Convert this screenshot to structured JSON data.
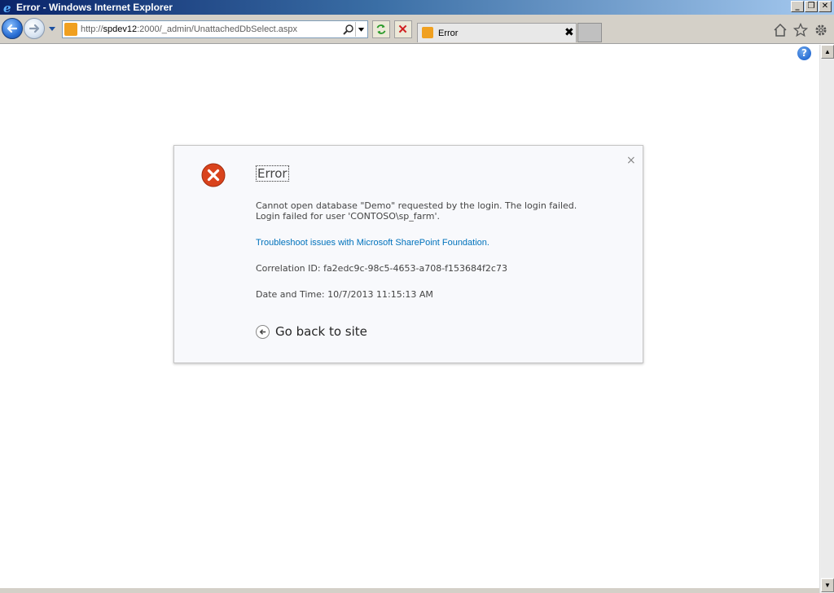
{
  "window": {
    "title": "Error - Windows Internet Explorer",
    "minimize": "_",
    "maximize": "❐",
    "close": "✕"
  },
  "navbar": {
    "url_prefix": "http://",
    "url_domain": "spdev12",
    "url_rest": ":2000/_admin/UnattachedDbSelect.aspx"
  },
  "tab": {
    "label": "Error",
    "close": "✖"
  },
  "page": {
    "help": "?"
  },
  "dialog": {
    "title": "Error",
    "close": "×",
    "message_line1": "Cannot open database \"Demo\" requested by the login. The login failed.",
    "message_line2": "Login failed for user 'CONTOSO\\sp_farm'.",
    "troubleshoot_link": "Troubleshoot issues with Microsoft SharePoint Foundation.",
    "correlation": "Correlation ID: fa2edc9c-98c5-4653-a708-f153684f2c73",
    "datetime": "Date and Time: 10/7/2013 11:15:13 AM",
    "go_back": "Go back to site"
  },
  "colors": {
    "error_red": "#d9431c",
    "link_blue": "#0072bc"
  },
  "icons": [
    "ie-logo-icon",
    "back-arrow-icon",
    "forward-arrow-icon",
    "search-icon",
    "refresh-icon",
    "stop-icon",
    "home-icon",
    "favorites-star-icon",
    "tools-gear-icon",
    "help-icon",
    "error-icon",
    "back-circle-icon"
  ]
}
